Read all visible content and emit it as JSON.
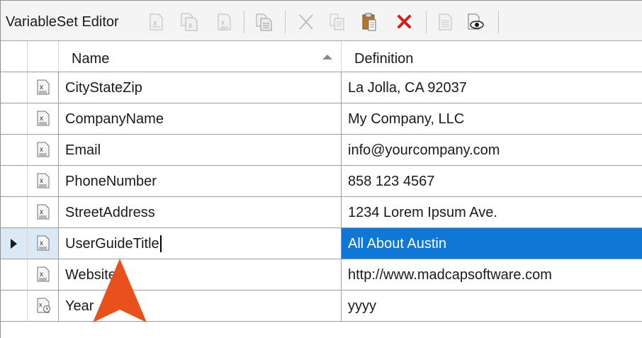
{
  "window": {
    "title": "VariableSet Editor"
  },
  "toolbar": {
    "buttons": [
      {
        "name": "new-variable",
        "icon": "new-variable-icon",
        "enabled": false
      },
      {
        "name": "new-variable-copy",
        "icon": "duplicate-variable-icon",
        "enabled": false
      },
      {
        "name": "edit-variable",
        "icon": "edit-variable-icon",
        "enabled": false
      },
      {
        "name": "import-variables",
        "icon": "import-icon",
        "enabled": false
      },
      {
        "name": "cut",
        "icon": "cut-icon",
        "enabled": false
      },
      {
        "name": "copy",
        "icon": "copy-icon",
        "enabled": false
      },
      {
        "name": "paste",
        "icon": "paste-icon",
        "enabled": true
      },
      {
        "name": "delete",
        "icon": "delete-icon",
        "enabled": true,
        "color": "#d31d1d"
      },
      {
        "name": "properties",
        "icon": "properties-icon",
        "enabled": false
      },
      {
        "name": "preview",
        "icon": "preview-icon",
        "enabled": true
      }
    ]
  },
  "grid": {
    "columns": {
      "name": "Name",
      "definition": "Definition"
    },
    "sort": {
      "column": "Name",
      "direction": "ascending"
    },
    "rows": [
      {
        "name": "CityStateZip",
        "definition": "La Jolla, CA 92037",
        "icon": "text-variable-icon",
        "selected": false
      },
      {
        "name": "CompanyName",
        "definition": "My Company, LLC",
        "icon": "text-variable-icon",
        "selected": false
      },
      {
        "name": "Email",
        "definition": "info@yourcompany.com",
        "icon": "text-variable-icon",
        "selected": false
      },
      {
        "name": "PhoneNumber",
        "definition": "858 123 4567",
        "icon": "text-variable-icon",
        "selected": false
      },
      {
        "name": "StreetAddress",
        "definition": "1234 Lorem Ipsum Ave.",
        "icon": "text-variable-icon",
        "selected": false
      },
      {
        "name": "UserGuideTitle",
        "definition": "All About Austin",
        "icon": "text-variable-icon",
        "selected": true
      },
      {
        "name": "Website",
        "definition": "http://www.madcapsoftware.com",
        "icon": "text-variable-icon",
        "selected": false
      },
      {
        "name": "Year",
        "definition": "yyyy",
        "icon": "datetime-variable-icon",
        "selected": false
      }
    ]
  },
  "colors": {
    "selection": "#0f78d6",
    "row_header_selected": "#dbe9f7",
    "annotation_arrow": "#e8501e"
  }
}
